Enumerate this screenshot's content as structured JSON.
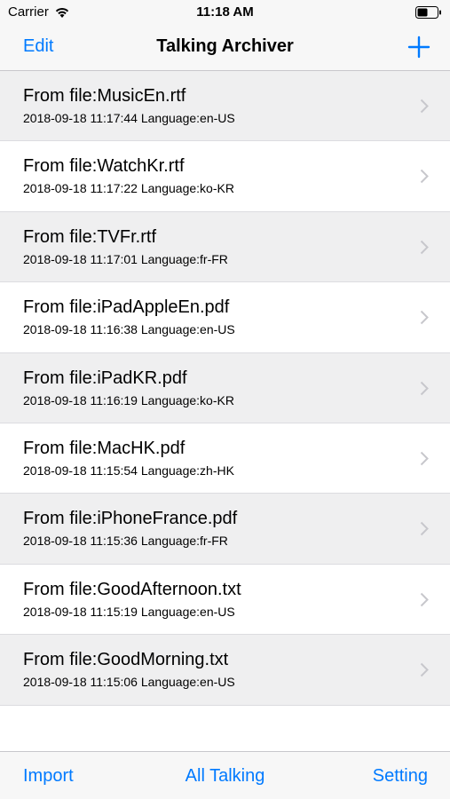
{
  "status_bar": {
    "carrier": "Carrier",
    "time": "11:18 AM",
    "wifi_icon": "wifi-icon",
    "battery_icon": "battery-icon"
  },
  "nav": {
    "edit_label": "Edit",
    "title": "Talking Archiver",
    "add_icon": "plus-icon"
  },
  "items": [
    {
      "title": "From file:MusicEn.rtf",
      "subtitle": "2018-09-18 11:17:44 Language:en-US"
    },
    {
      "title": "From file:WatchKr.rtf",
      "subtitle": "2018-09-18 11:17:22 Language:ko-KR"
    },
    {
      "title": "From file:TVFr.rtf",
      "subtitle": "2018-09-18 11:17:01 Language:fr-FR"
    },
    {
      "title": "From file:iPadAppleEn.pdf",
      "subtitle": "2018-09-18 11:16:38 Language:en-US"
    },
    {
      "title": "From file:iPadKR.pdf",
      "subtitle": "2018-09-18 11:16:19 Language:ko-KR"
    },
    {
      "title": "From file:MacHK.pdf",
      "subtitle": "2018-09-18 11:15:54 Language:zh-HK"
    },
    {
      "title": "From file:iPhoneFrance.pdf",
      "subtitle": "2018-09-18 11:15:36 Language:fr-FR"
    },
    {
      "title": "From file:GoodAfternoon.txt",
      "subtitle": "2018-09-18 11:15:19 Language:en-US"
    },
    {
      "title": "From file:GoodMorning.txt",
      "subtitle": "2018-09-18 11:15:06 Language:en-US"
    }
  ],
  "tabs": {
    "import_label": "Import",
    "all_label": "All Talking",
    "setting_label": "Setting"
  },
  "colors": {
    "accent": "#007aff",
    "row_alt": "#efeff0",
    "bar_bg": "#f7f7f7"
  }
}
